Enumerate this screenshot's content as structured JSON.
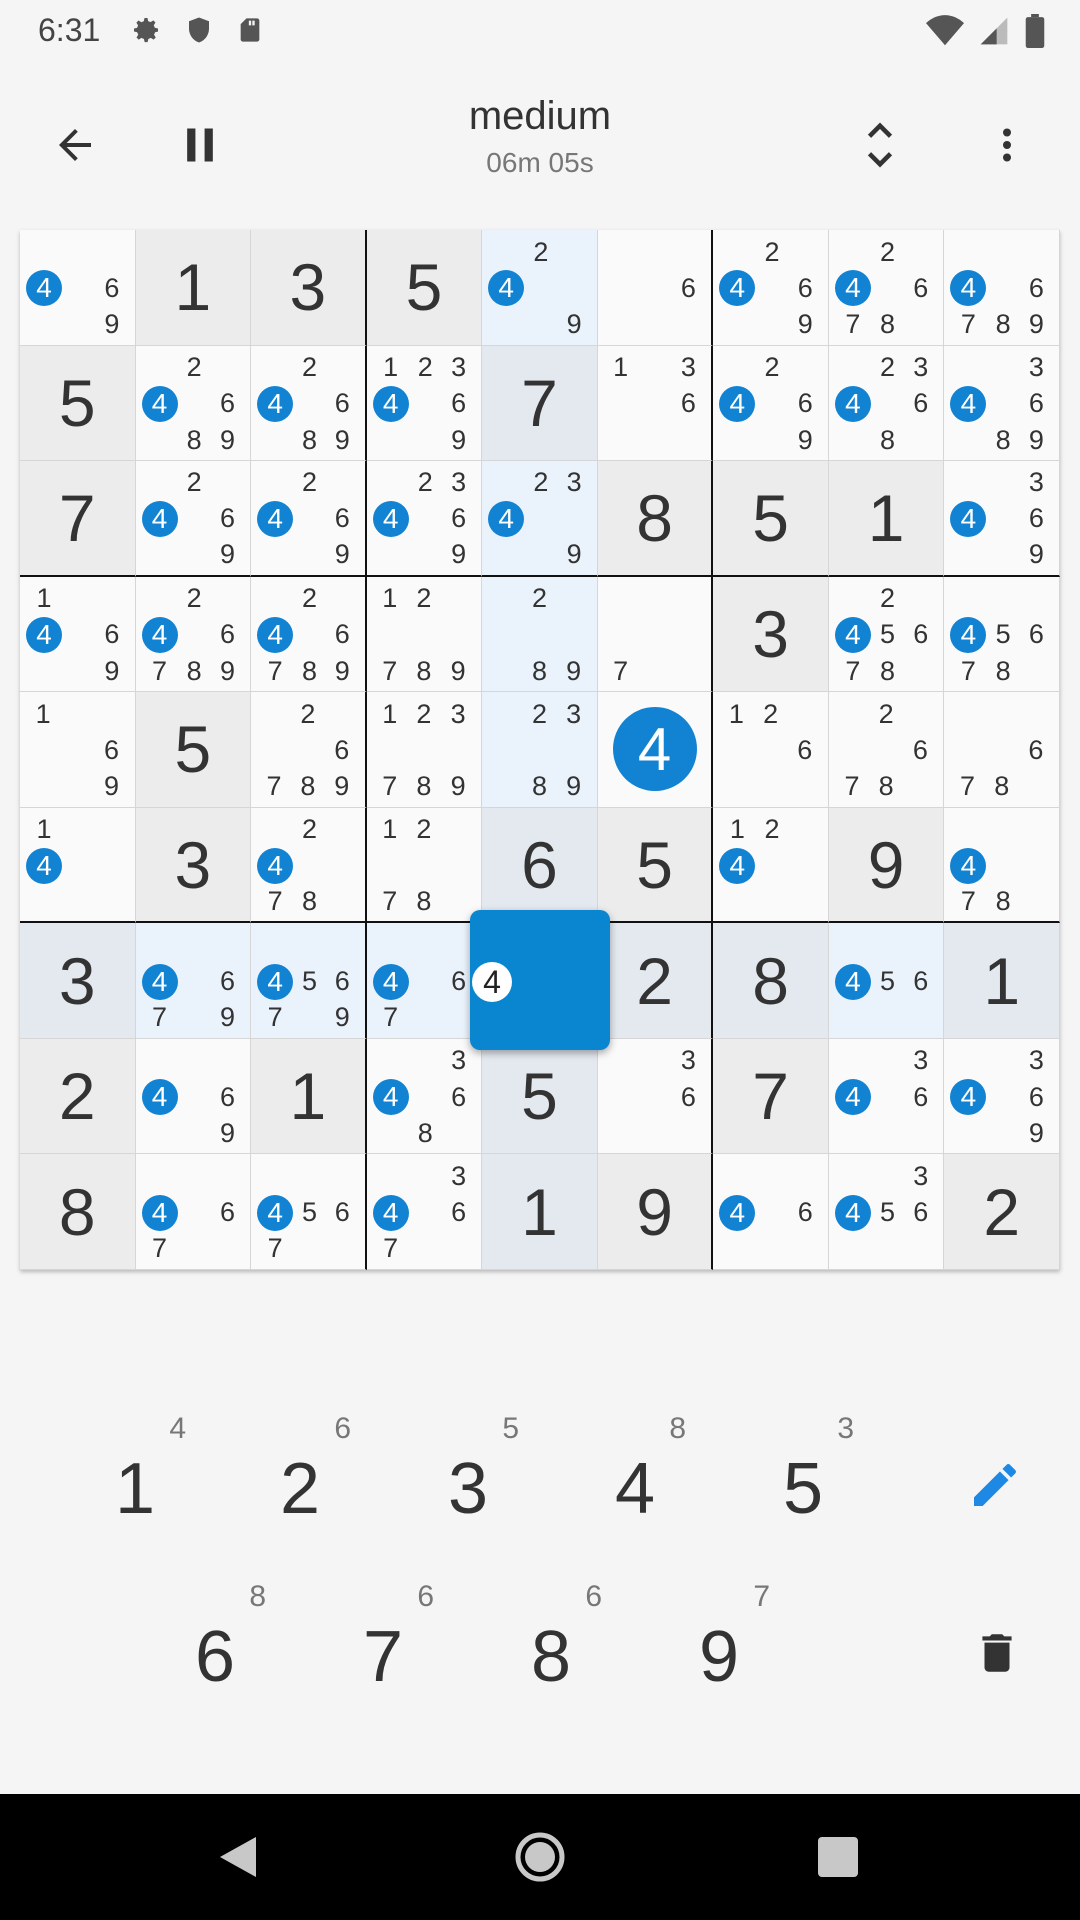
{
  "status_bar": {
    "time": "6:31",
    "icons_left": [
      "settings-icon",
      "shield-icon",
      "sd-card-icon"
    ],
    "icons_right": [
      "wifi-icon",
      "cell-signal-icon",
      "battery-icon"
    ]
  },
  "app_bar": {
    "title": "medium",
    "timer": "06m 05s",
    "actions": [
      "back-arrow-icon",
      "pause-icon",
      "expand-collapse-icon",
      "more-vert-icon"
    ]
  },
  "board": {
    "given": [
      [
        0,
        1,
        1,
        1,
        0,
        0,
        0,
        0,
        0
      ],
      [
        1,
        0,
        0,
        0,
        1,
        0,
        0,
        0,
        0
      ],
      [
        1,
        0,
        0,
        0,
        0,
        1,
        1,
        1,
        0
      ],
      [
        0,
        0,
        0,
        0,
        0,
        0,
        1,
        0,
        0
      ],
      [
        0,
        1,
        0,
        0,
        0,
        0,
        0,
        0,
        0
      ],
      [
        0,
        1,
        0,
        0,
        1,
        1,
        0,
        1,
        0
      ],
      [
        1,
        0,
        0,
        0,
        0,
        1,
        1,
        0,
        1
      ],
      [
        1,
        0,
        1,
        0,
        1,
        0,
        1,
        0,
        0
      ],
      [
        1,
        0,
        0,
        0,
        1,
        1,
        0,
        0,
        1
      ]
    ],
    "values": [
      [
        "",
        "1",
        "3",
        "5",
        "",
        "",
        "",
        "",
        ""
      ],
      [
        "5",
        "",
        "",
        "",
        "7",
        "",
        "",
        "",
        ""
      ],
      [
        "7",
        "",
        "",
        "",
        "",
        "8",
        "5",
        "1",
        ""
      ],
      [
        "",
        "",
        "",
        "",
        "",
        "",
        "3",
        "",
        ""
      ],
      [
        "",
        "5",
        "",
        "",
        "",
        "4",
        "",
        "",
        ""
      ],
      [
        "",
        "3",
        "",
        "",
        "6",
        "5",
        "",
        "9",
        ""
      ],
      [
        "3",
        "",
        "",
        "",
        "",
        "2",
        "8",
        "",
        "1"
      ],
      [
        "2",
        "",
        "1",
        "",
        "5",
        "",
        "7",
        "",
        ""
      ],
      [
        "8",
        "",
        "",
        "",
        "1",
        "9",
        "",
        "",
        "2"
      ]
    ],
    "notes": [
      [
        [
          4,
          6,
          9
        ],
        [],
        [],
        [],
        [
          2,
          4,
          9
        ],
        [
          6
        ],
        [
          2,
          4,
          6,
          9
        ],
        [
          2,
          4,
          6,
          7,
          8
        ],
        [
          4,
          6,
          7,
          8,
          9
        ]
      ],
      [
        [],
        [
          2,
          4,
          6,
          8,
          9
        ],
        [
          2,
          4,
          6,
          8,
          9
        ],
        [
          1,
          2,
          3,
          4,
          6,
          9
        ],
        [],
        [
          1,
          3,
          6
        ],
        [
          2,
          4,
          6,
          9
        ],
        [
          2,
          3,
          4,
          6,
          8
        ],
        [
          3,
          4,
          6,
          8,
          9
        ]
      ],
      [
        [],
        [
          2,
          4,
          6,
          9
        ],
        [
          2,
          4,
          6,
          9
        ],
        [
          2,
          3,
          4,
          6,
          9
        ],
        [
          2,
          3,
          4,
          9
        ],
        [],
        [],
        [],
        [
          3,
          4,
          6,
          9
        ]
      ],
      [
        [
          1,
          4,
          6,
          9
        ],
        [
          2,
          4,
          6,
          7,
          8,
          9
        ],
        [
          2,
          4,
          6,
          7,
          8,
          9
        ],
        [
          1,
          2,
          7,
          8,
          9
        ],
        [
          2,
          8,
          9
        ],
        [
          7
        ],
        [],
        [
          2,
          4,
          5,
          6,
          7,
          8
        ],
        [
          4,
          5,
          6,
          7,
          8
        ]
      ],
      [
        [
          1,
          6,
          9
        ],
        [],
        [
          2,
          6,
          7,
          8,
          9
        ],
        [
          1,
          2,
          3,
          7,
          8,
          9
        ],
        [
          2,
          3,
          8,
          9
        ],
        [],
        [
          1,
          2,
          6
        ],
        [
          2,
          6,
          7,
          8
        ],
        [
          6,
          7,
          8
        ]
      ],
      [
        [
          1,
          4
        ],
        [],
        [
          2,
          4,
          7,
          8
        ],
        [
          1,
          2,
          7,
          8
        ],
        [],
        [],
        [
          1,
          2,
          4
        ],
        [],
        [
          4,
          7,
          8
        ]
      ],
      [
        [],
        [
          4,
          6,
          7,
          9
        ],
        [
          4,
          5,
          6,
          7,
          9
        ],
        [
          4,
          6,
          7
        ],
        [
          4
        ],
        [],
        [],
        [
          4,
          5,
          6
        ],
        []
      ],
      [
        [],
        [
          4,
          6,
          9
        ],
        [],
        [
          3,
          4,
          6,
          8
        ],
        [],
        [
          3,
          6
        ],
        [],
        [
          3,
          4,
          6
        ],
        [
          3,
          4,
          6,
          9
        ]
      ],
      [
        [],
        [
          4,
          6,
          7
        ],
        [
          4,
          5,
          6,
          7
        ],
        [
          3,
          4,
          6,
          7
        ],
        [],
        [],
        [
          4,
          6
        ],
        [
          3,
          4,
          5,
          6
        ],
        []
      ]
    ],
    "highlight_row": 6,
    "highlight_col": 4,
    "selected_cell": [
      6,
      4
    ],
    "emphasized_digit": 4
  },
  "keypad": {
    "digits": [
      {
        "digit": "1",
        "count": "4"
      },
      {
        "digit": "2",
        "count": "6"
      },
      {
        "digit": "3",
        "count": "5"
      },
      {
        "digit": "4",
        "count": "8"
      },
      {
        "digit": "5",
        "count": "3"
      },
      {
        "digit": "6",
        "count": "8"
      },
      {
        "digit": "7",
        "count": "6"
      },
      {
        "digit": "8",
        "count": "6"
      },
      {
        "digit": "9",
        "count": "7"
      }
    ],
    "tools": [
      "pencil-icon",
      "delete-icon"
    ],
    "accent_color": "#1e88e5"
  },
  "nav_bar": {
    "buttons": [
      "back-triangle-icon",
      "home-circle-icon",
      "recents-square-icon"
    ]
  },
  "colors": {
    "badge_blue": "#1283d2",
    "selected_blue": "#0a86d1",
    "highlight": "#eaf3fc",
    "given_bg": "#ececec"
  }
}
